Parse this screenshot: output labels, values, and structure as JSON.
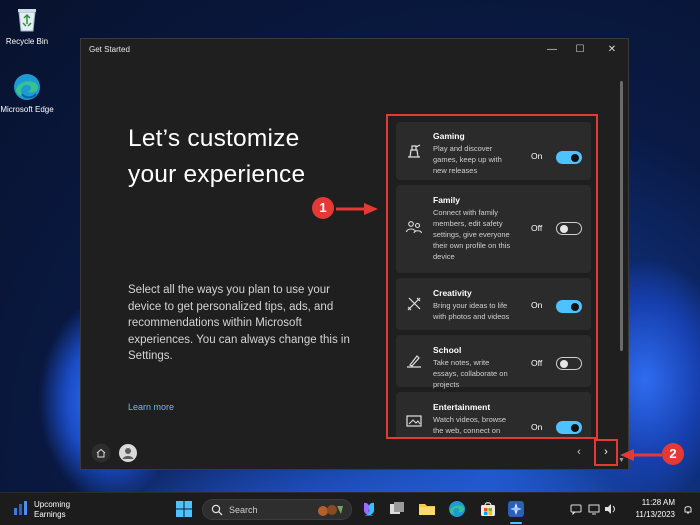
{
  "desktop": {
    "icons": [
      {
        "label": "Recycle Bin",
        "icon": "recycle-bin-icon"
      },
      {
        "label": "Microsoft Edge",
        "icon": "edge-icon"
      }
    ]
  },
  "window": {
    "title": "Get Started",
    "controls": {
      "minimize": "—",
      "maximize": "☐",
      "close": "✕"
    },
    "heading": "Let’s customize your experience",
    "description": "Select all the ways you plan to use your device to get personalized tips, ads, and recommendations within Microsoft experiences. You can always change this in Settings.",
    "learn_more": "Learn more",
    "options": [
      {
        "name": "Gaming",
        "description": "Play and discover games, keep up with new releases",
        "state": "On",
        "enabled": true,
        "icon": "gaming-icon"
      },
      {
        "name": "Family",
        "description": "Connect with family members, edit safety settings, give everyone their own profile on this device",
        "state": "Off",
        "enabled": false,
        "icon": "family-icon"
      },
      {
        "name": "Creativity",
        "description": "Bring your ideas to life with photos and videos",
        "state": "On",
        "enabled": true,
        "icon": "creativity-icon"
      },
      {
        "name": "School",
        "description": "Take notes, write essays, collaborate on projects",
        "state": "Off",
        "enabled": false,
        "icon": "school-icon"
      },
      {
        "name": "Entertainment",
        "description": "Watch videos, browse the web, connect on",
        "state": "On",
        "enabled": true,
        "icon": "entertainment-icon"
      }
    ],
    "nav": {
      "prev": "‹",
      "next": "›"
    }
  },
  "callouts": {
    "first": "1",
    "second": "2"
  },
  "taskbar": {
    "weather_line1": "Upcoming",
    "weather_line2": "Earnings",
    "search_label": "Search",
    "time": "11:28 AM",
    "date": "11/13/2023"
  },
  "colors": {
    "accent": "#4cc2ff",
    "callout": "#e53935",
    "window_bg": "#1f1f1f",
    "card_bg": "#2b2b2b",
    "link": "#74b3ff"
  }
}
